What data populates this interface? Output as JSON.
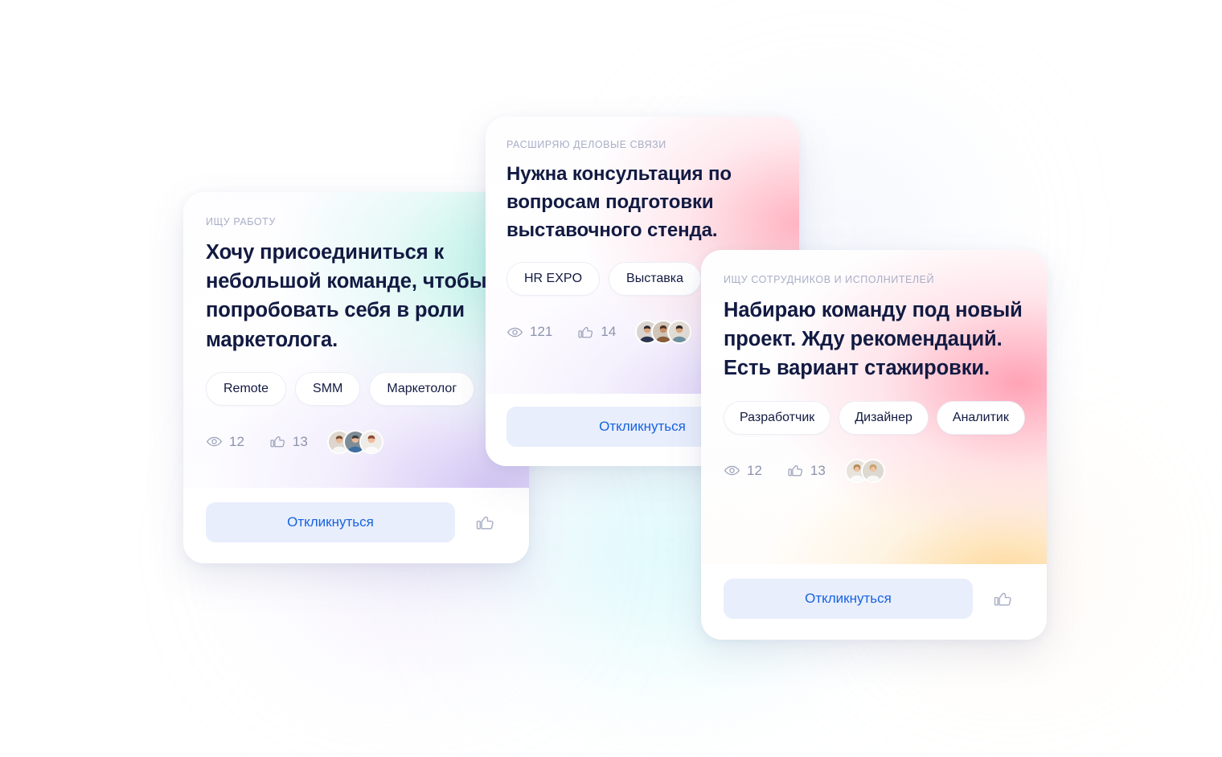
{
  "theme": {
    "accent_blue": "#1763e0",
    "button_bg": "#e8eefc",
    "headline_color": "#121a42",
    "eyebrow_color": "#a8aec6",
    "meta_color": "#8c93ac",
    "page_background": "#ffffff"
  },
  "cards": [
    {
      "id": "card-1",
      "eyebrow": "ИЩУ РАБОТУ",
      "headline": "Хочу присоединиться к небольшой команде, чтобы попробовать себя в роли маркетолога.",
      "tags": [
        "Remote",
        "SMM",
        "Маркетолог"
      ],
      "views": "12",
      "likes": "13",
      "avatar_count": 3,
      "respond_label": "Откликнуться",
      "icons": {
        "views": "eye-icon",
        "likes": "thumbs-up-icon",
        "like_button": "thumbs-up-icon"
      }
    },
    {
      "id": "card-2",
      "eyebrow": "РАСШИРЯЮ ДЕЛОВЫЕ СВЯЗИ",
      "headline": "Нужна консультация по вопросам подготовки выставочного стенда.",
      "tags": [
        "HR EXPO",
        "Выставка"
      ],
      "views": "121",
      "likes": "14",
      "avatar_count": 3,
      "respond_label": "Откликнуться",
      "icons": {
        "views": "eye-icon",
        "likes": "thumbs-up-icon",
        "like_button": "thumbs-up-icon"
      }
    },
    {
      "id": "card-3",
      "eyebrow": "ИЩУ СОТРУДНИКОВ И ИСПОЛНИТЕЛЕЙ",
      "headline": "Набираю команду под новый проект. Жду рекомендаций. Есть вариант стажировки.",
      "tags": [
        "Разработчик",
        "Дизайнер",
        "Аналитик"
      ],
      "views": "12",
      "likes": "13",
      "avatar_count": 2,
      "respond_label": "Откликнуться",
      "icons": {
        "views": "eye-icon",
        "likes": "thumbs-up-icon",
        "like_button": "thumbs-up-icon"
      }
    }
  ]
}
